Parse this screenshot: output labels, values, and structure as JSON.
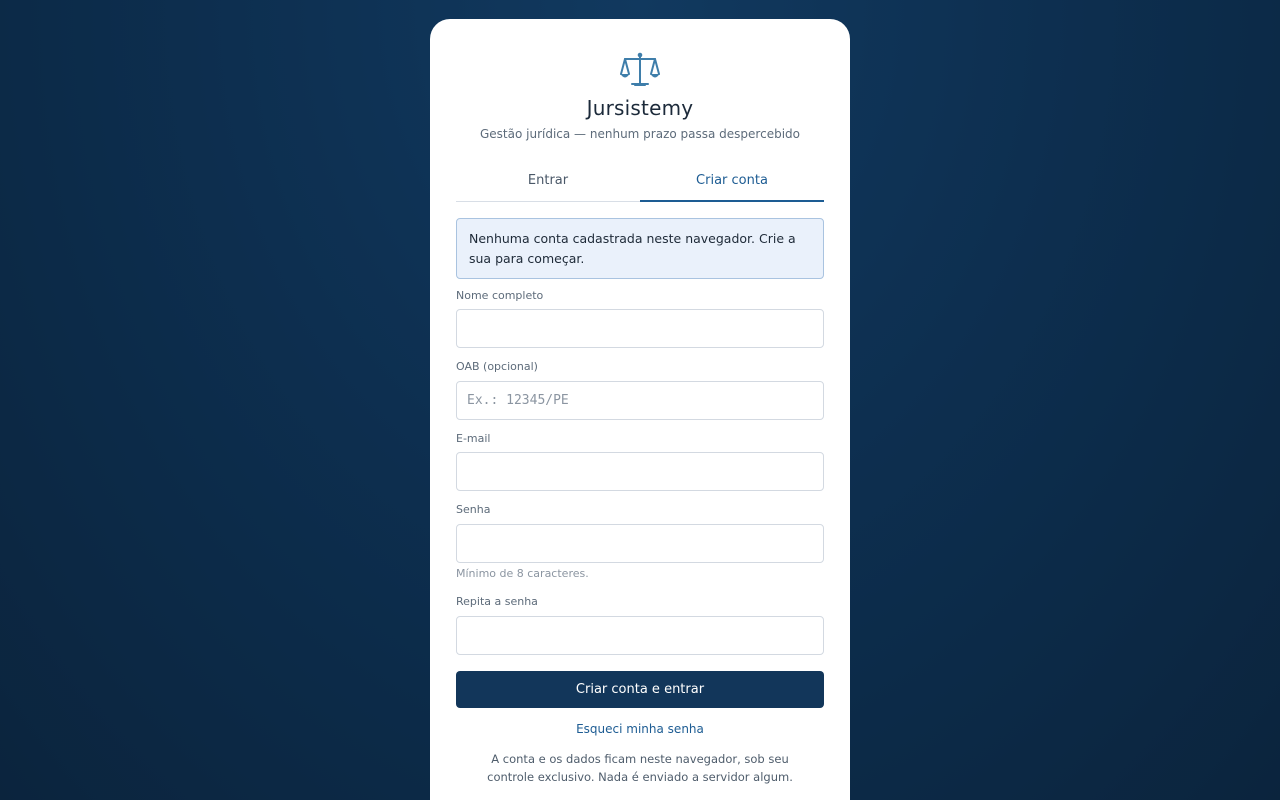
{
  "brand": {
    "logo_icon": "scales-of-justice-icon",
    "title": "Jursistemy",
    "subtitle": "Gestão jurídica — nenhum prazo passa despercebido"
  },
  "tabs": [
    {
      "label": "Entrar",
      "active": false
    },
    {
      "label": "Criar conta",
      "active": true
    }
  ],
  "notice": "Nenhuma conta cadastrada neste navegador. Crie a sua para começar.",
  "form": {
    "full_name": {
      "label": "Nome completo",
      "value": "",
      "placeholder": ""
    },
    "oab": {
      "label": "OAB (opcional)",
      "value": "",
      "placeholder": "Ex.: 12345/PE"
    },
    "email": {
      "label": "E-mail",
      "value": "",
      "placeholder": ""
    },
    "password": {
      "label": "Senha",
      "value": "",
      "placeholder": "",
      "hint": "Mínimo de 8 caracteres."
    },
    "password_confirm": {
      "label": "Repita a senha",
      "value": "",
      "placeholder": ""
    },
    "submit_label": "Criar conta e entrar",
    "forgot_label": "Esqueci minha senha"
  },
  "footnote": "A conta e os dados ficam neste navegador, sob seu controle exclusivo. Nada é enviado a servidor algum.",
  "colors": {
    "background": "#0d2f50",
    "accent": "#1d5c93",
    "primary_button": "#12365a",
    "notice_bg": "#eaf1fb"
  }
}
